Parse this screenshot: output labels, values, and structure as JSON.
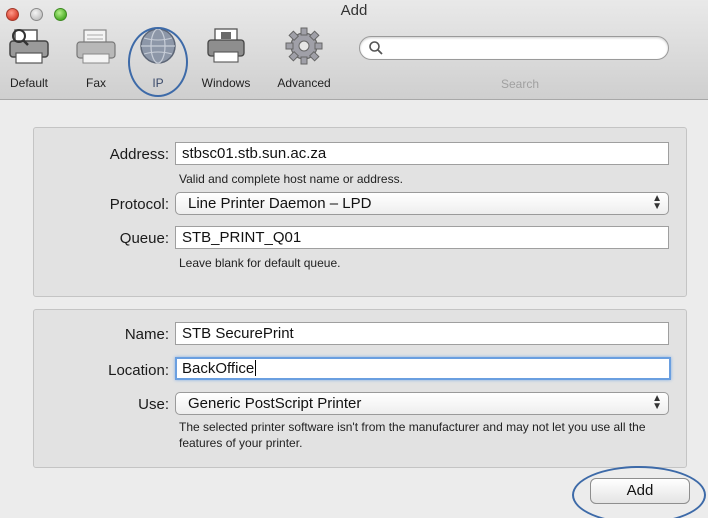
{
  "window": {
    "title": "Add"
  },
  "toolbar": {
    "items": [
      {
        "label": "Default",
        "icon": "default-printer-icon"
      },
      {
        "label": "Fax",
        "icon": "fax-icon"
      },
      {
        "label": "IP",
        "icon": "ip-globe-icon",
        "selected": true
      },
      {
        "label": "Windows",
        "icon": "windows-printer-icon"
      },
      {
        "label": "Advanced",
        "icon": "advanced-gear-icon"
      }
    ],
    "search_label": "Search"
  },
  "connection": {
    "address_label": "Address:",
    "address_value": "stbsc01.stb.sun.ac.za",
    "address_hint": "Valid and complete host name or address.",
    "protocol_label": "Protocol:",
    "protocol_value": "Line Printer Daemon – LPD",
    "queue_label": "Queue:",
    "queue_value": "STB_PRINT_Q01",
    "queue_hint": "Leave blank for default queue."
  },
  "printer": {
    "name_label": "Name:",
    "name_value": "STB SecurePrint",
    "location_label": "Location:",
    "location_value": "BackOffice",
    "use_label": "Use:",
    "use_value": "Generic PostScript Printer",
    "use_hint": "The selected printer software isn't from the manufacturer and may not let you use all the features of your printer."
  },
  "actions": {
    "add_label": "Add"
  },
  "colors": {
    "annotation": "#3d6aa8",
    "focus_ring": "#6a9fe0"
  }
}
